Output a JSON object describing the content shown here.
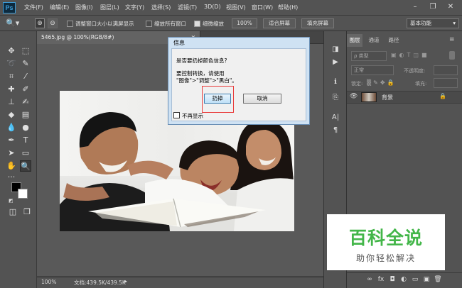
{
  "app": {
    "logo": "Ps",
    "accent": "#3d9bd6"
  },
  "menu": [
    "文件(F)",
    "编辑(E)",
    "图像(I)",
    "图层(L)",
    "文字(Y)",
    "选择(S)",
    "滤镜(T)",
    "3D(D)",
    "视图(V)",
    "窗口(W)",
    "帮助(H)"
  ],
  "window_controls": {
    "minimize": "–",
    "restore": "❐",
    "close": "✕"
  },
  "options": {
    "resize_windows": "调整窗口大小以满屏显示",
    "zoom_all": "缩放所有窗口",
    "scrubby_zoom": "细微缩放",
    "zoom_value": "100%",
    "fit_screen": "适合屏幕",
    "fill_screen": "填充屏幕",
    "workspace": "基本功能"
  },
  "document": {
    "tab": "5465.jpg @ 100%(RGB/8#)",
    "zoom": "100%",
    "doc_info": "文档:439.5K/439.5K"
  },
  "layers_panel": {
    "tabs": [
      "图层",
      "通道",
      "路径"
    ],
    "kind_filter": "类型",
    "blend_mode": "正常",
    "opacity_label": "不透明度:",
    "fill_label": "填充:",
    "lock_label": "锁定:",
    "layer_name": "背景"
  },
  "dialog": {
    "title": "信息",
    "question": "是否要扔掉颜色信息?",
    "hint_line1": "要控制转换，请使用",
    "hint_line2": "\"图像\">\"调整\">\"黑白\"。",
    "discard": "扔掉",
    "cancel": "取消",
    "dont_show": "不再显示"
  },
  "watermark": {
    "title": "百科全说",
    "subtitle": "助你轻松解决"
  }
}
